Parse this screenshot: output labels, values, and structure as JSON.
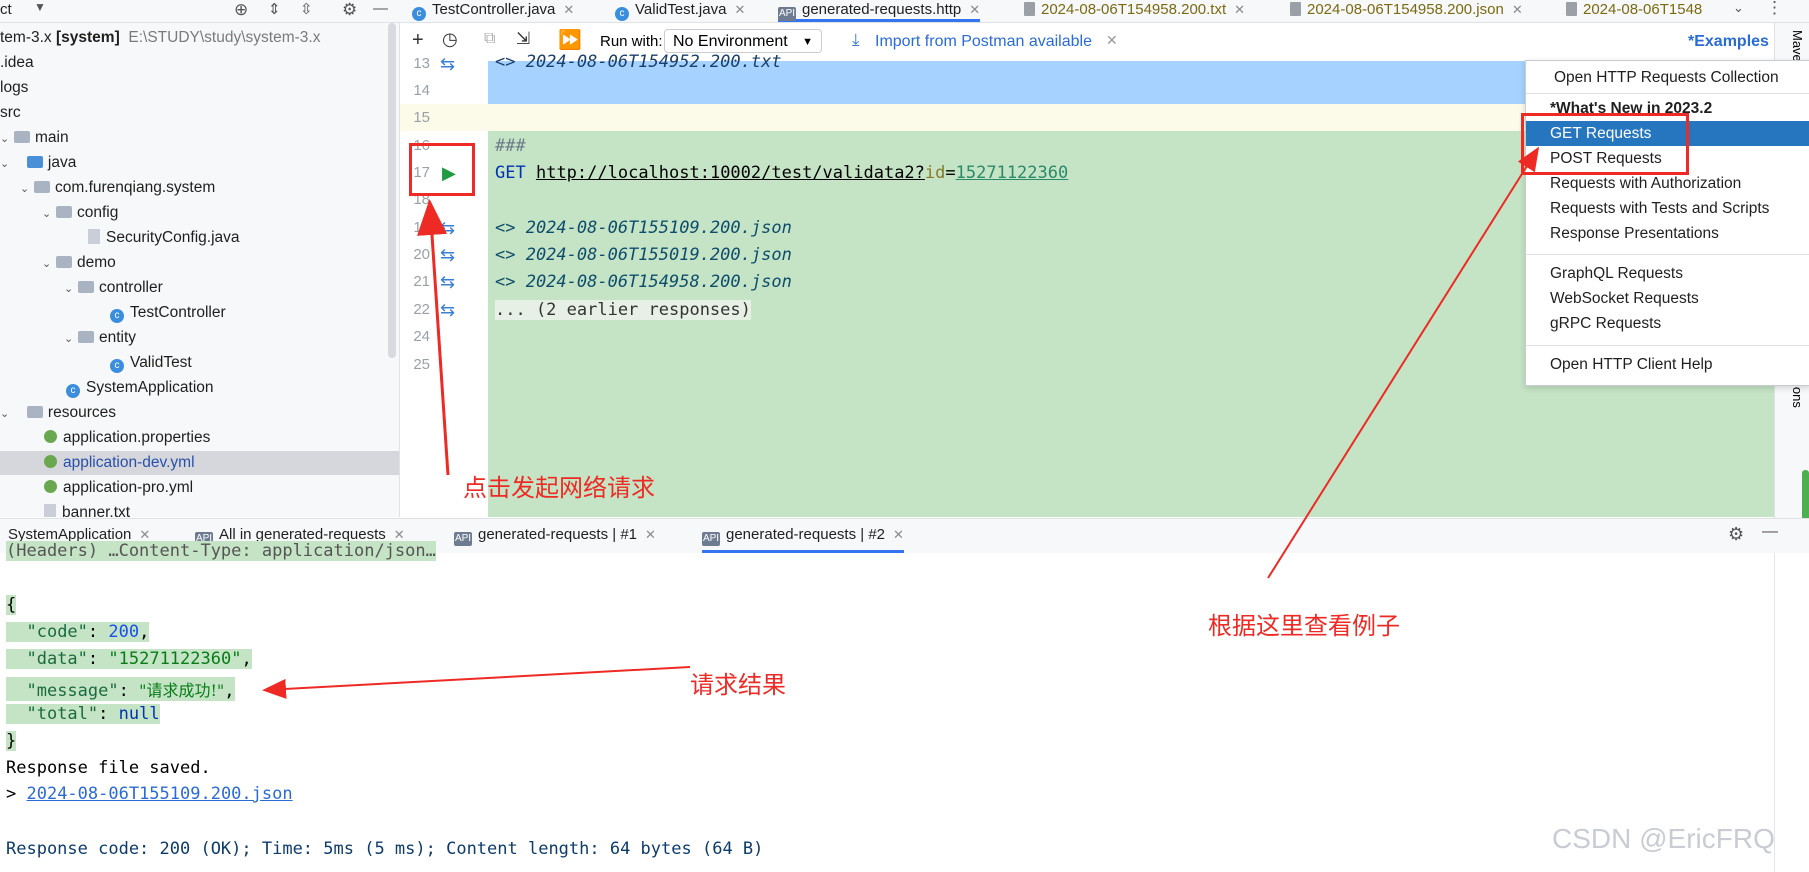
{
  "tabs": [
    {
      "label": "TestController.java",
      "icon": "class-icon"
    },
    {
      "label": "ValidTest.java",
      "icon": "class-icon"
    },
    {
      "label": "generated-requests.http",
      "icon": "api-icon",
      "active": true
    },
    {
      "label": "2024-08-06T154958.200.txt",
      "icon": "text-file-icon"
    },
    {
      "label": "2024-08-06T154958.200.json",
      "icon": "json-file-icon"
    },
    {
      "label": "2024-08-06T1548",
      "icon": "text-file-icon"
    }
  ],
  "top_left_label": "ct",
  "tree": {
    "root_name": "tem-3.x",
    "root_bold": "[system]",
    "root_path": "E:\\STUDY\\study\\system-3.x",
    "items": [
      {
        "label": ".idea"
      },
      {
        "label": "logs"
      },
      {
        "label": "src"
      },
      {
        "label": "main"
      },
      {
        "label": "java"
      },
      {
        "label": "com.furenqiang.system"
      },
      {
        "label": "config"
      },
      {
        "label": "SecurityConfig.java"
      },
      {
        "label": "demo"
      },
      {
        "label": "controller"
      },
      {
        "label": "TestController"
      },
      {
        "label": "entity"
      },
      {
        "label": "ValidTest"
      },
      {
        "label": "SystemApplication"
      },
      {
        "label": "resources"
      },
      {
        "label": "application.properties"
      },
      {
        "label": "application-dev.yml"
      },
      {
        "label": "application-pro.yml"
      },
      {
        "label": "banner.txt"
      }
    ]
  },
  "editor_toolbar": {
    "run_with_label": "Run with:",
    "environment": "No Environment",
    "import_label": "Import from Postman available",
    "examples_label": "*Examples"
  },
  "editor": {
    "line_numbers": [
      "13",
      "14",
      "15",
      "16",
      "17",
      "18",
      "19",
      "20",
      "21",
      "22",
      "24",
      "25"
    ],
    "line13": "<> 2024-08-06T154952.200.txt",
    "separator": "###",
    "method": "GET",
    "url_base": "http://localhost:10002/test/validata2?",
    "param_key": "id",
    "param_eq": "=",
    "param_value": "15271122360",
    "responses": [
      "<> 2024-08-06T155109.200.json",
      "<> 2024-08-06T155019.200.json",
      "<> 2024-08-06T154958.200.json"
    ],
    "earlier": "... (2 earlier responses)"
  },
  "menu": {
    "items": [
      "Open HTTP Requests Collection",
      "*What's New in 2023.2",
      "GET Requests",
      "POST Requests",
      "Requests with Authorization",
      "Requests with Tests and Scripts",
      "Response Presentations",
      "GraphQL Requests",
      "WebSocket Requests",
      "gRPC Requests",
      "Open HTTP Client Help"
    ],
    "selected": "GET Requests"
  },
  "side_labels": {
    "maven": "Mave",
    "notifications": "ions"
  },
  "bottom_tabs": [
    {
      "label": "SystemApplication"
    },
    {
      "label": "All in generated-requests"
    },
    {
      "label": "generated-requests | #1"
    },
    {
      "label": "generated-requests | #2",
      "active": true
    }
  ],
  "console": {
    "headers": "(Headers) …Content-Type: application/json…",
    "open_brace": "{",
    "code_key": "\"code\"",
    "code_val": "200",
    "data_key": "\"data\"",
    "data_val": "\"15271122360\"",
    "message_key": "\"message\"",
    "message_val": "\"请求成功!\"",
    "total_key": "\"total\"",
    "total_val": "null",
    "close_brace": "}",
    "saved": "Response file saved.",
    "saved_prefix": "> ",
    "saved_file": "2024-08-06T155109.200.json",
    "status": "Response code: 200 (OK); Time: 5ms (5 ms); Content length: 64 bytes (64 B)"
  },
  "annotations": {
    "click_hint": "点击发起网络请求",
    "examples_hint": "根据这里查看例子",
    "result_hint": "请求结果"
  },
  "watermark": "CSDN @EricFRQ",
  "colors": {
    "annotation": "#ee2a24",
    "highlight": "#c5e3c5",
    "selection": "#2675bf",
    "editor_selection": "#a6d2ff"
  }
}
